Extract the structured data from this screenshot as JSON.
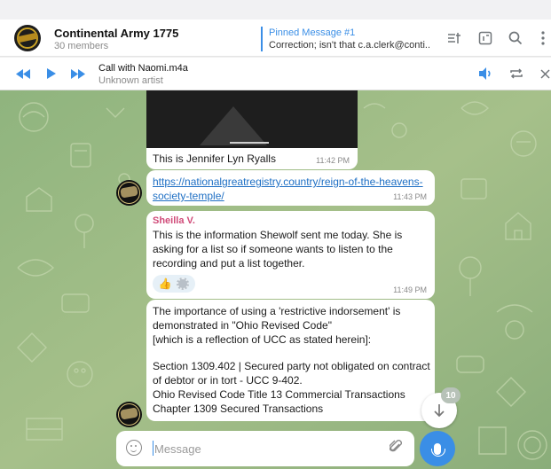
{
  "header": {
    "chat_title": "Continental Army 1775",
    "members": "30 members",
    "pinned_title": "Pinned Message #1",
    "pinned_text": "Correction; isn't that c.a.clerk@conti..."
  },
  "header_icons": [
    "list-filter-icon",
    "sidebar-panel-icon",
    "search-icon",
    "more-vertical-icon"
  ],
  "player": {
    "track_title": "Call with Naomi.m4a",
    "artist": "Unknown artist"
  },
  "messages": [
    {
      "text": "This is Jennifer Lyn Ryalls",
      "time": "11:42 PM"
    },
    {
      "link": "https://nationalgreatregistry.country/reign-of-the-heavens-society-temple/",
      "time": "11:43 PM"
    },
    {
      "sender": "Sheilla V.",
      "text": "This is the information Shewolf sent me today. She is asking for a list so if someone wants to listen to the recording and put a list together.",
      "time": "11:49 PM"
    },
    {
      "lines": [
        "The importance of using a 'restrictive indorsement' is demonstrated in \"Ohio Revised Code\"",
        "[which is a reflection of UCC as stated herein]:",
        "Section 1309.402 | Secured party not obligated on contract of debtor or in tort - UCC 9-402.",
        "Ohio Revised Code  Title 13 Commercial Transactions",
        "Chapter 1309 Secured Transactions"
      ]
    }
  ],
  "scroll": {
    "unread_count": "10"
  },
  "composer": {
    "placeholder": "Message"
  },
  "colors": {
    "accent": "#3a8ee6",
    "chat_bg": "#9ab782",
    "sender_name": "#d04b79"
  }
}
